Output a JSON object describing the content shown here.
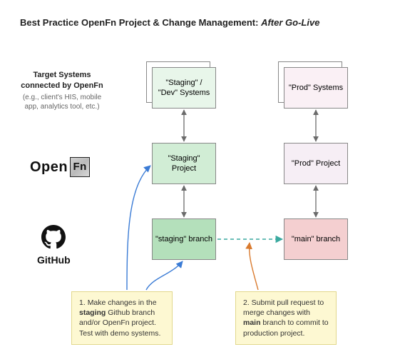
{
  "title_prefix": "Best Practice OpenFn Project & Change Management: ",
  "title_italic": "After Go-Live",
  "row_label_systems_bold": "Target Systems connected by OpenFn",
  "row_label_systems_sub": "(e.g., client's HIS, mobile app, analytics tool, etc.)",
  "openfn_logo_text": "Open",
  "openfn_badge_text": "Fn",
  "github_label": "GitHub",
  "staging_systems_label": "\"Staging\" / \"Dev\" Systems",
  "prod_systems_label": "\"Prod\" Systems",
  "staging_project_label": "\"Staging\" Project",
  "prod_project_label": "\"Prod\" Project",
  "staging_branch_label": "\"staging\" branch",
  "main_branch_label": "\"main\" branch",
  "note1_num": "1.",
  "note1_text_a": "Make changes in the ",
  "note1_bold": "staging",
  "note1_text_b": " Github branch and/or OpenFn project. Test with demo systems.",
  "note2_num": "2.",
  "note2_text_a": " Submit pull request to merge changes with ",
  "note2_bold": "main",
  "note2_text_b": " branch to commit to production project.",
  "colors": {
    "arrow_gray": "#6b6b6b",
    "arrow_blue": "#3a7bd5",
    "arrow_teal": "#3aa99f",
    "arrow_orange": "#d97a2e"
  }
}
